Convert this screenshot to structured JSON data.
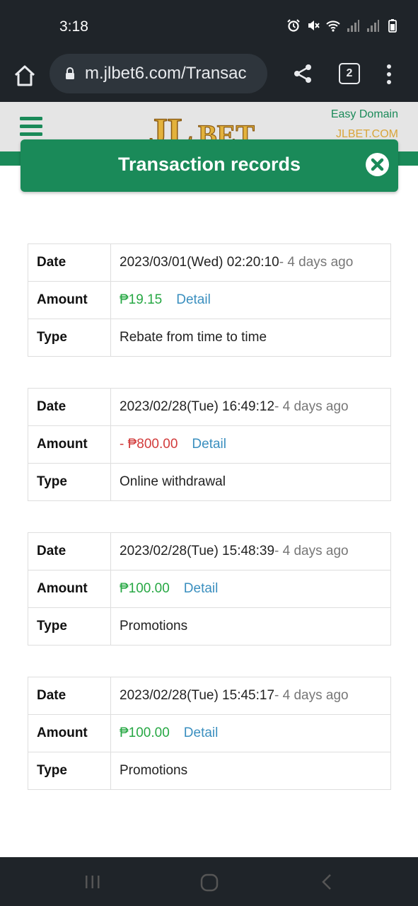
{
  "status_bar": {
    "time": "3:18",
    "icons": [
      "alarm-icon",
      "mute-icon",
      "wifi-icon",
      "signal-icon",
      "signal-icon",
      "battery-icon"
    ]
  },
  "browser": {
    "url": "m.jlbet6.com/Transac",
    "tab_count": "2"
  },
  "site_header": {
    "logo_text": "JLBET",
    "easy_domain_label": "Easy Domain",
    "domain_label": "JLBET.COM"
  },
  "modal": {
    "title": "Transaction records"
  },
  "labels": {
    "date": "Date",
    "amount": "Amount",
    "type": "Type",
    "detail": "Detail"
  },
  "records": [
    {
      "date": "2023/03/01(Wed) 02:20:10",
      "ago": "- 4 days ago",
      "amount": "₱19.15",
      "sign": "positive",
      "type": "Rebate from time to time"
    },
    {
      "date": "2023/02/28(Tue) 16:49:12",
      "ago": "- 4 days ago",
      "amount": "- ₱800.00",
      "sign": "negative",
      "type": "Online withdrawal"
    },
    {
      "date": "2023/02/28(Tue) 15:48:39",
      "ago": "- 4 days ago",
      "amount": "₱100.00",
      "sign": "positive",
      "type": "Promotions"
    },
    {
      "date": "2023/02/28(Tue) 15:45:17",
      "ago": "- 4 days ago",
      "amount": "₱100.00",
      "sign": "positive",
      "type": "Promotions"
    }
  ],
  "colors": {
    "brand_green": "#1a8a59",
    "positive": "#27a844",
    "negative": "#d23b3b",
    "link": "#3a8fbf"
  }
}
